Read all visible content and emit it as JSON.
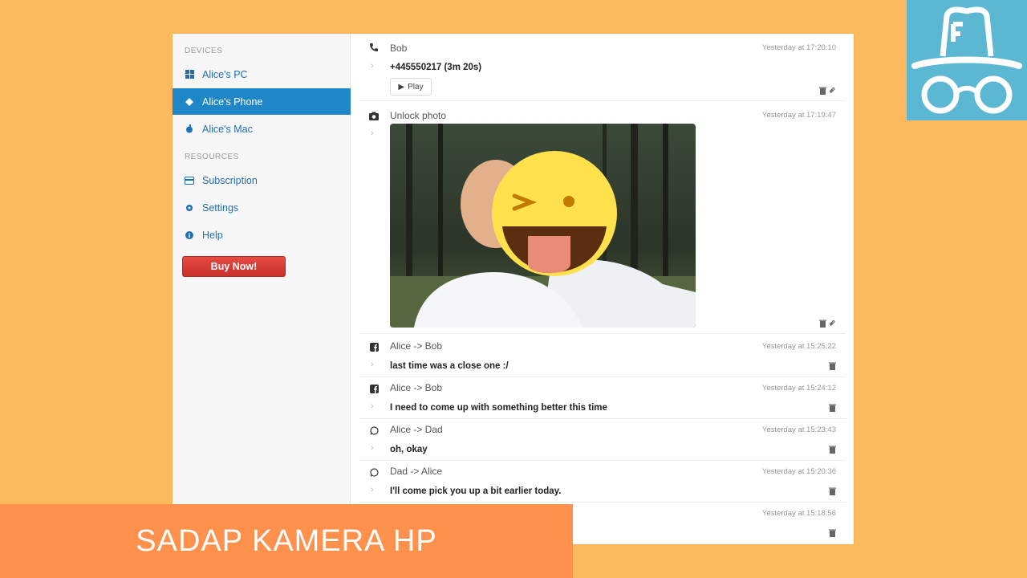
{
  "sidebar": {
    "devices_heading": "DEVICES",
    "resources_heading": "RESOURCES",
    "devices": [
      {
        "label": "Alice's PC",
        "icon": "windows-icon"
      },
      {
        "label": "Alice's Phone",
        "icon": "android-icon",
        "active": true
      },
      {
        "label": "Alice's Mac",
        "icon": "apple-icon"
      }
    ],
    "resources": [
      {
        "label": "Subscription",
        "icon": "card-icon"
      },
      {
        "label": "Settings",
        "icon": "gear-icon"
      },
      {
        "label": "Help",
        "icon": "info-icon"
      }
    ],
    "buy_label": "Buy Now!"
  },
  "feed": {
    "call": {
      "title": "Bob",
      "time": "Yesterday at 17:20:10",
      "detail": "+445550217 (3m 20s)",
      "play_label": "Play"
    },
    "photo": {
      "title": "Unlock photo",
      "time": "Yesterday at 17:19:47"
    },
    "messages": [
      {
        "title": "Alice -> Bob",
        "time": "Yesterday at 15:25:22",
        "text": "last time was a close one :/",
        "app": "facebook"
      },
      {
        "title": "Alice -> Bob",
        "time": "Yesterday at 15:24:12",
        "text": "I need to come up with something better this time",
        "app": "facebook"
      },
      {
        "title": "Alice -> Dad",
        "time": "Yesterday at 15:23:43",
        "text": "oh, okay",
        "app": "whatsapp"
      },
      {
        "title": "Dad -> Alice",
        "time": "Yesterday at 15:20:36",
        "text": "I'll come pick you up a bit earlier today.",
        "app": "whatsapp"
      }
    ],
    "last": {
      "time": "Yesterday at 15:18:56"
    }
  },
  "banner": {
    "text": "SADAP KAMERA HP"
  },
  "colors": {
    "background": "#fdb95d",
    "banner": "#ff914c",
    "logo_bg": "#5cb8d2",
    "active": "#1f86c8",
    "buy": "#d9363e"
  }
}
